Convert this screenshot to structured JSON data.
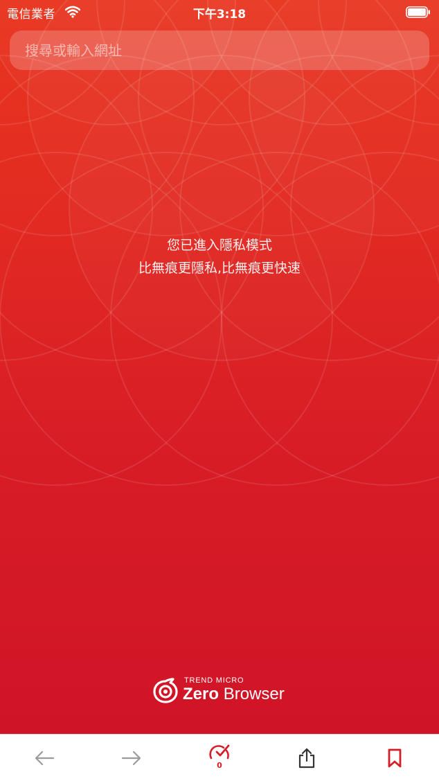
{
  "status_bar": {
    "carrier": "電信業者",
    "time": "下午3:18",
    "wifi_icon": "wifi-icon",
    "battery_icon": "battery-icon"
  },
  "address_bar": {
    "placeholder": "搜尋或輸入網址",
    "value": ""
  },
  "private_mode": {
    "line1": "您已進入隱私模式",
    "line2": "比無痕更隱私,比無痕更快速"
  },
  "brand": {
    "company": "TREND MICRO",
    "product_bold": "Zero",
    "product_light": "Browser",
    "logo_icon": "zero-browser-logo-icon"
  },
  "toolbar": {
    "back_icon": "arrow-left-icon",
    "forward_icon": "arrow-right-icon",
    "tracker_icon": "speedometer-check-icon",
    "tracker_count": "0",
    "share_icon": "share-icon",
    "bookmark_icon": "bookmark-icon"
  },
  "colors": {
    "accent": "#d51d27",
    "hero_top": "#e9361f",
    "hero_bottom": "#d01427",
    "toolbar_icon_disabled": "#9b9b9b",
    "toolbar_icon_active": "#333333"
  }
}
